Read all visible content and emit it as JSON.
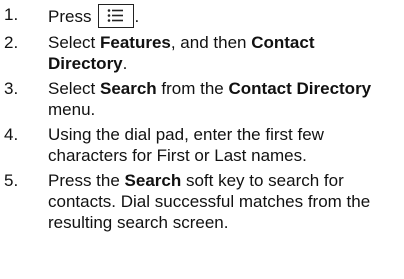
{
  "steps": [
    {
      "number": "1.",
      "press_label": "Press",
      "menu_key_icon": "menu-list-key-icon",
      "end_punct": "."
    },
    {
      "number": "2.",
      "t1": "Select ",
      "b1": "Features",
      "t2": ", and then ",
      "b2": "Contact Directory",
      "t3": "."
    },
    {
      "number": "3.",
      "t1": "Select ",
      "b1": "Search",
      "t2": " from the ",
      "b2": "Contact Directory",
      "t3": " menu."
    },
    {
      "number": "4.",
      "text": "Using the dial pad, enter the first few characters for First or Last names."
    },
    {
      "number": "5.",
      "t1": "Press the ",
      "b1": "Search",
      "t2": " soft key to search for contacts. Dial successful matches from the resulting search screen."
    }
  ]
}
